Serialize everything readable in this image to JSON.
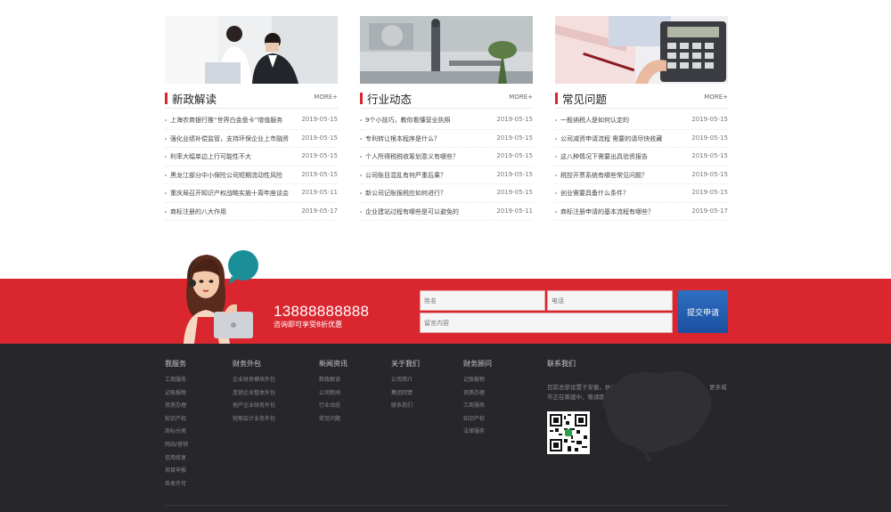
{
  "columns": [
    {
      "title": "新政解读",
      "more": "MORE+",
      "items": [
        {
          "text": "上海农商银行推“世界白金盘卡”增值服务",
          "date": "2019-05-15"
        },
        {
          "text": "强化业绩补偿监管，支持环保企业上市融资",
          "date": "2019-05-15"
        },
        {
          "text": "利率大幅单边上行可能性不大",
          "date": "2019-05-15"
        },
        {
          "text": "黑龙江部分中小保险公司短期流动性风险",
          "date": "2019-05-15"
        },
        {
          "text": "重庆局召开知识产权战略实施十周年座谈会",
          "date": "2019-05-11"
        },
        {
          "text": "商标注册的八大作用",
          "date": "2019-05-17"
        }
      ]
    },
    {
      "title": "行业动态",
      "more": "MORE+",
      "items": [
        {
          "text": "9个小技巧，教你看懂营业执照",
          "date": "2019-05-15"
        },
        {
          "text": "专利转让根本程序是什么？",
          "date": "2019-05-15"
        },
        {
          "text": "个人所得税税收筹划意义有哪些？",
          "date": "2019-05-15"
        },
        {
          "text": "公司账目混乱有何严重后果？",
          "date": "2019-05-15"
        },
        {
          "text": "新公司记账报税应如何进行？",
          "date": "2019-05-15"
        },
        {
          "text": "企业建站过程有哪些是可以避免的",
          "date": "2019-05-11"
        }
      ]
    },
    {
      "title": "常见问题",
      "more": "MORE+",
      "items": [
        {
          "text": "一般纳税人是如何认定的",
          "date": "2019-05-15"
        },
        {
          "text": "公司减资申请流程 需要的请尽快收藏",
          "date": "2019-05-15"
        },
        {
          "text": "这八种情况下需要出具验资报告",
          "date": "2019-05-15"
        },
        {
          "text": "税控开票系统有哪些常见问题？",
          "date": "2019-05-15"
        },
        {
          "text": "创业需要具备什么条件？",
          "date": "2019-05-15"
        },
        {
          "text": "商标注册申请的基本流程有哪些？",
          "date": "2019-05-17"
        }
      ]
    }
  ],
  "consult": {
    "phone": "13888888888",
    "subtitle": "咨询即可享受8折优惠",
    "name_placeholder": "姓名",
    "tel_placeholder": "电话",
    "message_placeholder": "留言内容",
    "submit_label": "提交申请"
  },
  "footer": {
    "columns": [
      {
        "title": "我服务",
        "links": [
          "工商服务",
          "记账报税",
          "资质办理",
          "知识产权",
          "商标分类",
          "网站/营销",
          "信用修复",
          "项目申报",
          "各类许可"
        ]
      },
      {
        "title": "财务外包",
        "links": [
          "企业财务模块外包",
          "连锁企业整体外包",
          "地产企业财务外包",
          "短期会计业务外包"
        ]
      },
      {
        "title": "新闻资讯",
        "links": [
          "新政解读",
          "公司新闻",
          "行业动态",
          "常见问题"
        ]
      },
      {
        "title": "关于我们",
        "links": [
          "公司简介",
          "集团回馈",
          "联系我们"
        ]
      },
      {
        "title": "财务顾问",
        "links": [
          "记账报税",
          "资质办理",
          "工商服务",
          "知识产权",
          "法律服务"
        ]
      }
    ],
    "contact_title": "联系我们",
    "contact_desc": "目前总部设置于安徽，杭州、广州、成都、武汉、深圳分公司，更多城市正在筹建中，敬请期待！"
  },
  "colors": {
    "accent": "#d9262f",
    "footer_bg": "#27272b",
    "submit": "#1b4fa0"
  }
}
